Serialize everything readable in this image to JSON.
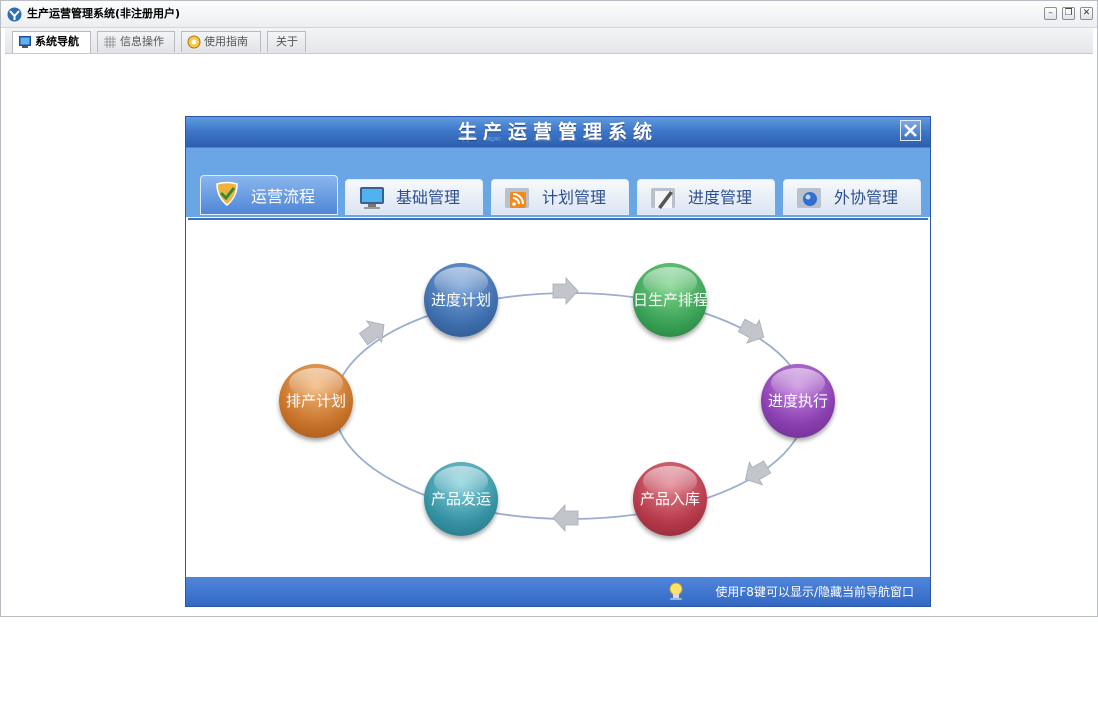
{
  "window": {
    "title": "生产运营管理系统(非注册用户)",
    "controls": {
      "minimize": "–",
      "restore": "❐",
      "close": "✕"
    }
  },
  "app_tabs": [
    {
      "label": "系统导航",
      "icon": "monitor-icon",
      "active": true
    },
    {
      "label": "信息操作",
      "icon": "grid-icon",
      "active": false
    },
    {
      "label": "使用指南",
      "icon": "help-icon",
      "active": false
    },
    {
      "label": "关于",
      "icon": "",
      "active": false
    }
  ],
  "nav": {
    "title": "生产运营管理系统",
    "close": "✕",
    "tabs": [
      {
        "label": "运营流程",
        "icon": "shield-icon",
        "active": true
      },
      {
        "label": "基础管理",
        "icon": "monitor-icon",
        "active": false
      },
      {
        "label": "计划管理",
        "icon": "rss-folder-icon",
        "active": false
      },
      {
        "label": "进度管理",
        "icon": "pen-folder-icon",
        "active": false
      },
      {
        "label": "外协管理",
        "icon": "globe-folder-icon",
        "active": false
      }
    ],
    "flow_nodes": [
      {
        "label": "进度计划",
        "color": "#3f6fae"
      },
      {
        "label": "日生产排程",
        "color": "#3aa257"
      },
      {
        "label": "进度执行",
        "color": "#8a3fb0"
      },
      {
        "label": "产品入库",
        "color": "#b63a4a"
      },
      {
        "label": "产品发运",
        "color": "#3592a3"
      },
      {
        "label": "排产计划",
        "color": "#c8732a"
      }
    ],
    "footer_hint": "使用F8键可以显示/隐藏当前导航窗口"
  }
}
